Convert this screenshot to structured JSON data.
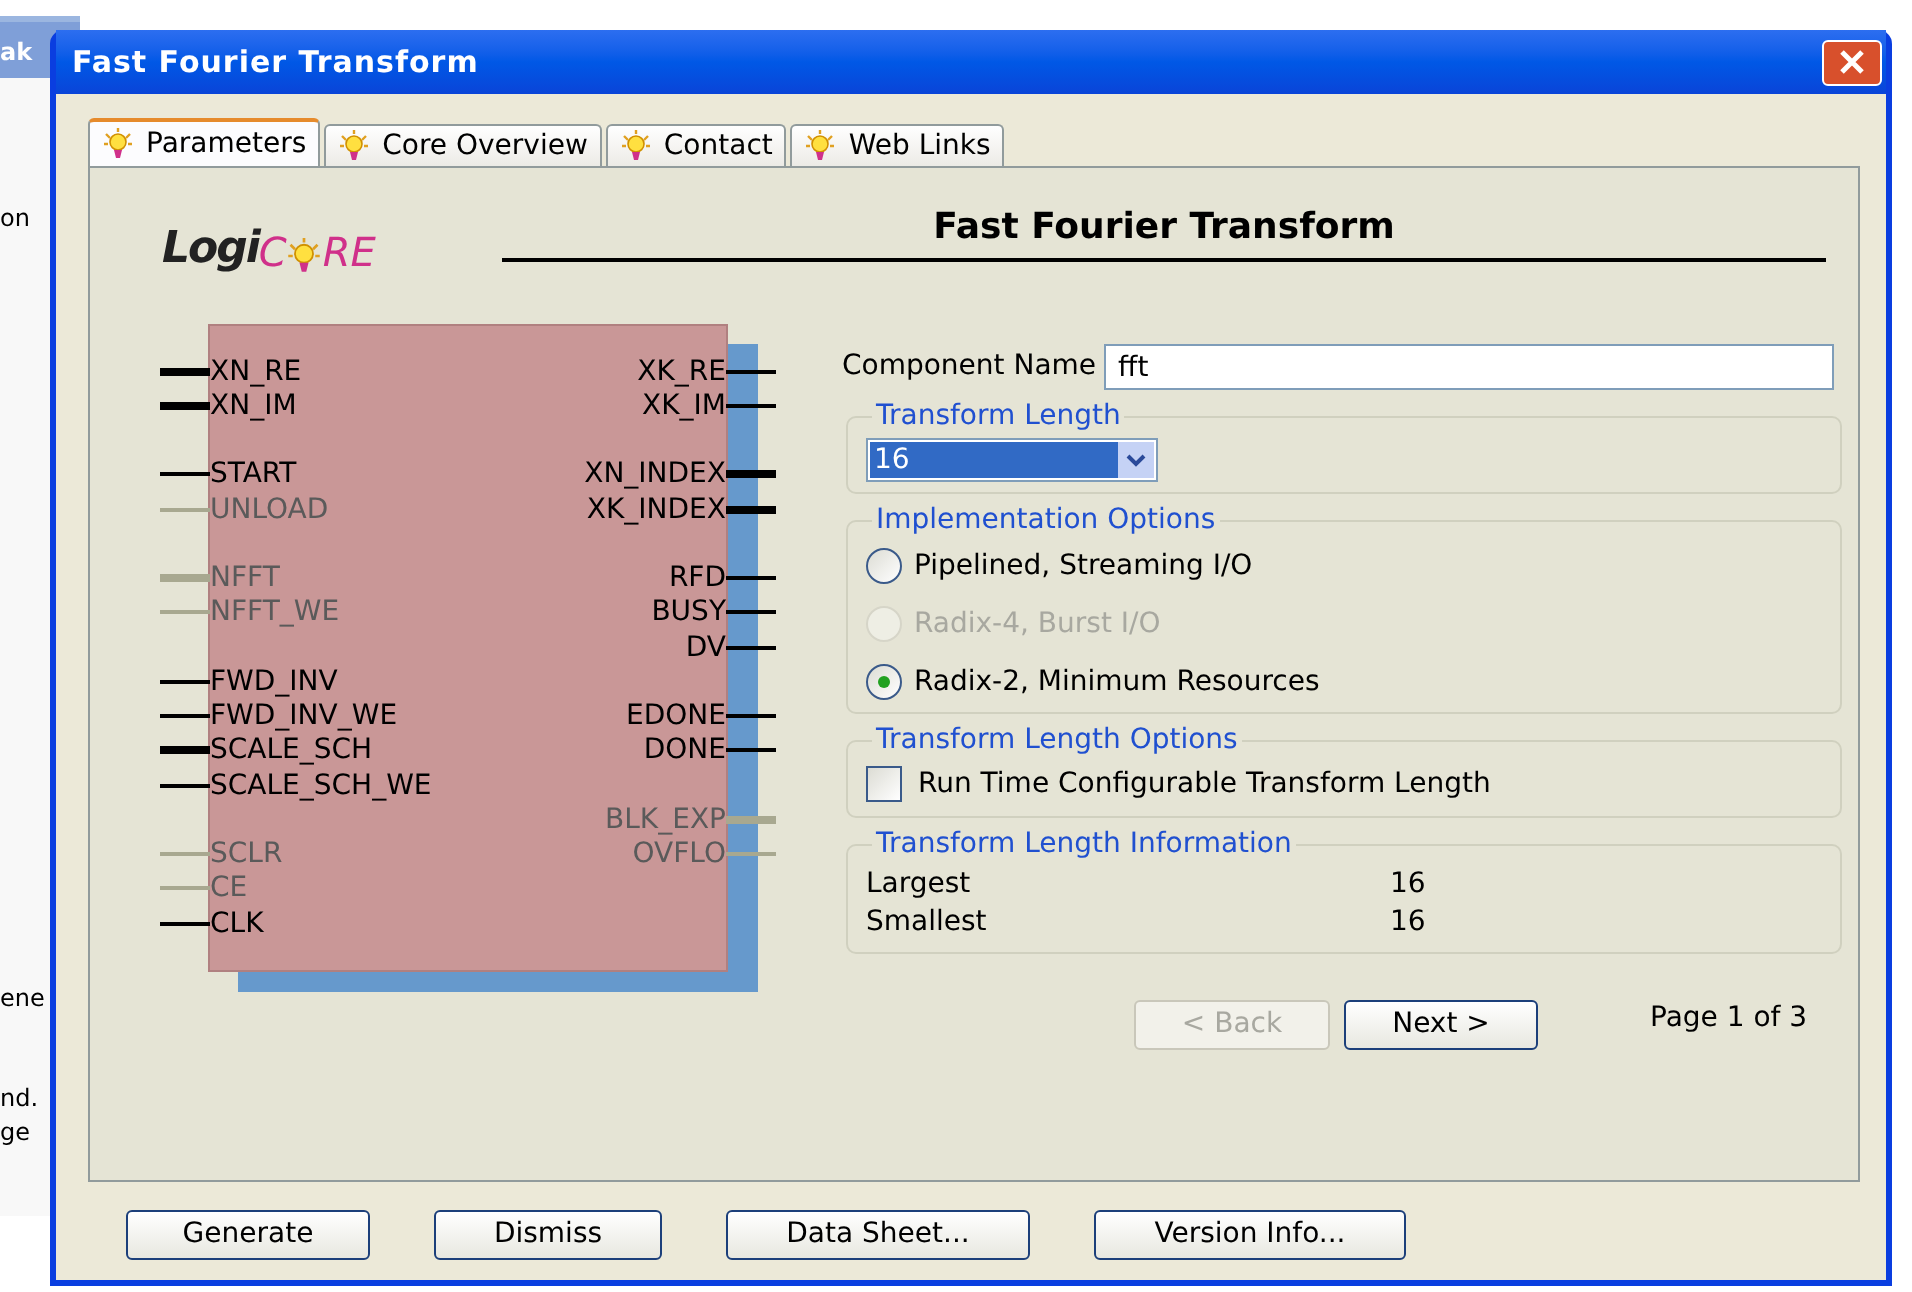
{
  "background_fragments": [
    "ak",
    "on",
    "ene",
    "nd.",
    "ge"
  ],
  "window": {
    "title": "Fast Fourier Transform"
  },
  "tabs": [
    {
      "label": "Parameters",
      "selected": true
    },
    {
      "label": "Core Overview",
      "selected": false
    },
    {
      "label": "Contact",
      "selected": false
    },
    {
      "label": "Web Links",
      "selected": false
    }
  ],
  "logo": {
    "prefix": "Logi",
    "before_bulb": "C",
    "after_bulb": "RE"
  },
  "heading": "Fast Fourier Transform",
  "symbol": {
    "left_groups": [
      [
        {
          "name": "XN_RE",
          "bus": true,
          "enabled": true
        },
        {
          "name": "XN_IM",
          "bus": true,
          "enabled": true
        }
      ],
      [
        {
          "name": "START",
          "bus": false,
          "enabled": true
        },
        {
          "name": "UNLOAD",
          "bus": false,
          "enabled": false
        }
      ],
      [
        {
          "name": "NFFT",
          "bus": true,
          "enabled": false
        },
        {
          "name": "NFFT_WE",
          "bus": false,
          "enabled": false
        }
      ],
      [
        {
          "name": "FWD_INV",
          "bus": false,
          "enabled": true
        },
        {
          "name": "FWD_INV_WE",
          "bus": false,
          "enabled": true
        },
        {
          "name": "SCALE_SCH",
          "bus": true,
          "enabled": true
        },
        {
          "name": "SCALE_SCH_WE",
          "bus": false,
          "enabled": true
        }
      ],
      [
        {
          "name": "SCLR",
          "bus": false,
          "enabled": false
        },
        {
          "name": "CE",
          "bus": false,
          "enabled": false
        },
        {
          "name": "CLK",
          "bus": false,
          "enabled": true
        }
      ]
    ],
    "right_groups": [
      [
        {
          "name": "XK_RE",
          "bus": false,
          "enabled": true
        },
        {
          "name": "XK_IM",
          "bus": false,
          "enabled": true
        }
      ],
      [
        {
          "name": "XN_INDEX",
          "bus": true,
          "enabled": true
        },
        {
          "name": "XK_INDEX",
          "bus": true,
          "enabled": true
        }
      ],
      [
        {
          "name": "RFD",
          "bus": false,
          "enabled": true
        },
        {
          "name": "BUSY",
          "bus": false,
          "enabled": true
        },
        {
          "name": "DV",
          "bus": false,
          "enabled": true
        }
      ],
      [
        {
          "name": "EDONE",
          "bus": false,
          "enabled": true
        },
        {
          "name": "DONE",
          "bus": false,
          "enabled": true
        }
      ],
      [
        {
          "name": "BLK_EXP",
          "bus": true,
          "enabled": false
        },
        {
          "name": "OVFLO",
          "bus": false,
          "enabled": false
        }
      ]
    ]
  },
  "component_name": {
    "label": "Component Name",
    "value": "fft"
  },
  "groups": [
    {
      "kind": "dropdown",
      "title": "Transform Length",
      "value": "16"
    },
    {
      "kind": "radios",
      "title": "Implementation Options",
      "options": [
        {
          "label": "Pipelined, Streaming I/O",
          "selected": false,
          "disabled": false
        },
        {
          "label": "Radix-4, Burst I/O",
          "selected": false,
          "disabled": true
        },
        {
          "label": "Radix-2, Minimum Resources",
          "selected": true,
          "disabled": false
        }
      ]
    },
    {
      "kind": "checkbox",
      "title": "Transform Length Options",
      "label": "Run Time Configurable Transform Length",
      "checked": false
    },
    {
      "kind": "info",
      "title": "Transform Length Information",
      "rows": [
        {
          "label": "Largest",
          "value": "16"
        },
        {
          "label": "Smallest",
          "value": "16"
        }
      ]
    }
  ],
  "nav": {
    "back": {
      "label": "< Back",
      "disabled": true
    },
    "next": {
      "label": "Next >",
      "disabled": false
    },
    "page": "Page 1 of 3"
  },
  "buttons": [
    "Generate",
    "Dismiss",
    "Data Sheet...",
    "Version Info..."
  ]
}
